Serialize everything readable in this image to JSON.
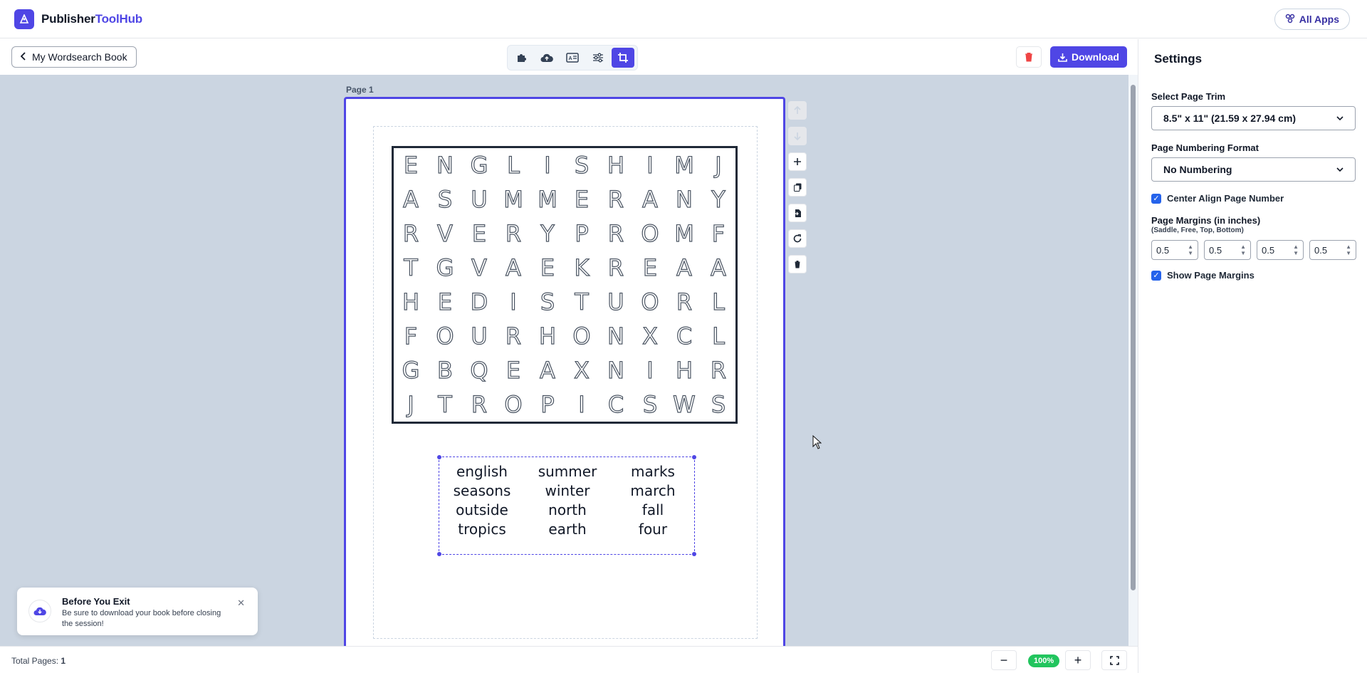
{
  "header": {
    "brand_main": "Publisher",
    "brand_accent": "ToolHub",
    "all_apps": "All Apps"
  },
  "toolbar": {
    "back_label": "My Wordsearch Book",
    "download_label": "Download",
    "tools": [
      "puzzle-icon",
      "cloud-upload-icon",
      "id-card-icon",
      "sliders-icon",
      "crop-icon"
    ]
  },
  "canvas": {
    "page_label": "Page 1",
    "grid": [
      [
        "E",
        "N",
        "G",
        "L",
        "I",
        "S",
        "H",
        "I",
        "M",
        "J"
      ],
      [
        "A",
        "S",
        "U",
        "M",
        "M",
        "E",
        "R",
        "A",
        "N",
        "Y"
      ],
      [
        "R",
        "V",
        "E",
        "R",
        "Y",
        "P",
        "R",
        "O",
        "M",
        "F"
      ],
      [
        "T",
        "G",
        "V",
        "A",
        "E",
        "K",
        "R",
        "E",
        "A",
        "A"
      ],
      [
        "H",
        "E",
        "D",
        "I",
        "S",
        "T",
        "U",
        "O",
        "R",
        "L"
      ],
      [
        "F",
        "O",
        "U",
        "R",
        "H",
        "O",
        "N",
        "X",
        "C",
        "L"
      ],
      [
        "G",
        "B",
        "Q",
        "E",
        "A",
        "X",
        "N",
        "I",
        "H",
        "R"
      ],
      [
        "J",
        "T",
        "R",
        "O",
        "P",
        "I",
        "C",
        "S",
        "W",
        "S"
      ]
    ],
    "words": [
      "english",
      "summer",
      "marks",
      "seasons",
      "winter",
      "march",
      "outside",
      "north",
      "fall",
      "tropics",
      "earth",
      "four"
    ]
  },
  "settings": {
    "title": "Settings",
    "trim_label": "Select Page Trim",
    "trim_value": "8.5\" x 11\" (21.59 x 27.94 cm)",
    "numbering_label": "Page Numbering Format",
    "numbering_value": "No Numbering",
    "center_label": "Center Align Page Number",
    "margins_label": "Page Margins (in inches)",
    "margins_sub": "(Saddle, Free, Top, Bottom)",
    "margins": [
      "0.5",
      "0.5",
      "0.5",
      "0.5"
    ],
    "show_margins_label": "Show Page Margins"
  },
  "footer": {
    "total_label": "Total Pages: ",
    "total_value": "1",
    "zoom": "100%"
  },
  "toast": {
    "title": "Before You Exit",
    "body": "Be sure to download your book before closing the session!"
  },
  "colors": {
    "accent": "#4f46e5",
    "canvas_bg": "#cbd5e1",
    "zoom_badge": "#22c55e",
    "danger": "#ef4444"
  }
}
